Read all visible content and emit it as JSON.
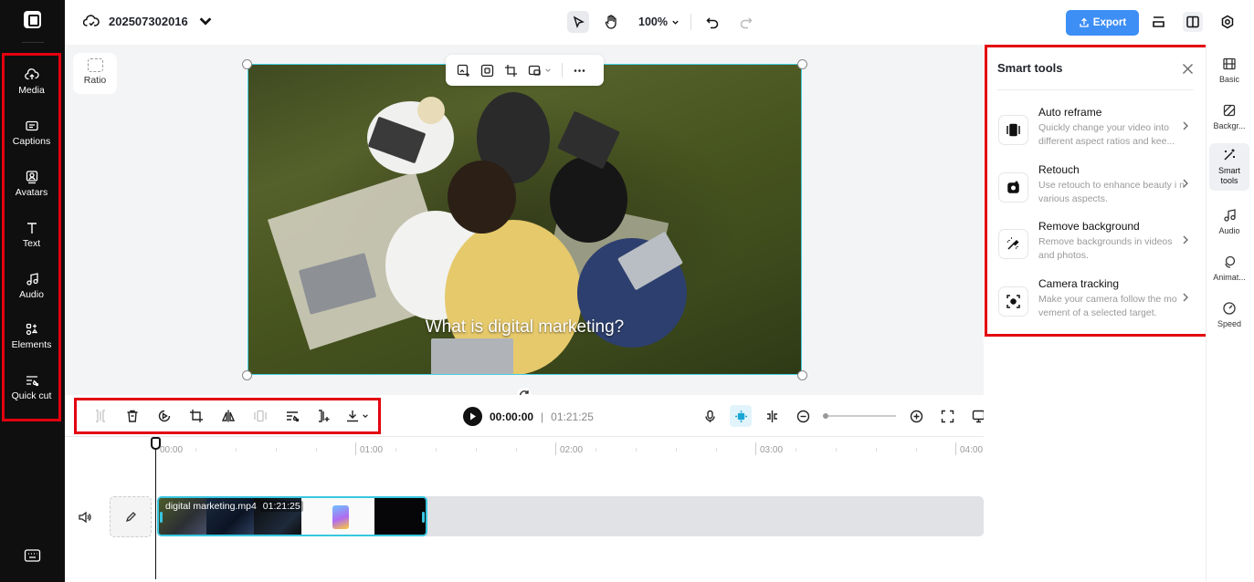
{
  "project": {
    "name": "202507302016"
  },
  "top": {
    "zoom": "100%",
    "export_label": "Export"
  },
  "left_rail": [
    {
      "label": "Media",
      "icon": "cloud-upload-icon"
    },
    {
      "label": "Captions",
      "icon": "captions-icon"
    },
    {
      "label": "Avatars",
      "icon": "avatar-icon"
    },
    {
      "label": "Text",
      "icon": "text-icon"
    },
    {
      "label": "Audio",
      "icon": "music-note-icon"
    },
    {
      "label": "Elements",
      "icon": "elements-icon"
    },
    {
      "label": "Quick cut",
      "icon": "quick-cut-icon"
    }
  ],
  "canvas": {
    "ratio_label": "Ratio",
    "caption": "What is digital marketing?"
  },
  "playback": {
    "current_time": "00:00:00",
    "separator": "|",
    "total_time": "01:21:25"
  },
  "ruler": [
    "00:00",
    "01:00",
    "02:00",
    "03:00",
    "04:00"
  ],
  "clip": {
    "name": "digital marketing.mp4",
    "duration": "01:21:25"
  },
  "smart_tools": {
    "title": "Smart tools",
    "items": [
      {
        "name": "Auto reframe",
        "desc": "Quickly change your video into different aspect ratios and kee...",
        "icon": "auto-reframe-icon"
      },
      {
        "name": "Retouch",
        "desc": "Use retouch to enhance beauty i n various aspects.",
        "icon": "retouch-icon"
      },
      {
        "name": "Remove background",
        "desc": "Remove backgrounds in videos and photos.",
        "icon": "remove-background-icon"
      },
      {
        "name": "Camera tracking",
        "desc": "Make your camera follow the mo vement of a selected target.",
        "icon": "camera-tracking-icon"
      }
    ]
  },
  "right_rail": [
    {
      "label": "Basic",
      "icon": "film-icon"
    },
    {
      "label": "Backgr...",
      "icon": "background-icon"
    },
    {
      "label": "Smart tools",
      "icon": "magic-wand-icon",
      "active": true
    },
    {
      "label": "Audio",
      "icon": "music-note-icon"
    },
    {
      "label": "Animat...",
      "icon": "animation-icon"
    },
    {
      "label": "Speed",
      "icon": "speed-icon"
    }
  ],
  "colors": {
    "accent": "#3d8ef5",
    "highlight": "#e3000f",
    "clip_border": "#38c6e0",
    "rail_bg": "#0f0f10"
  }
}
